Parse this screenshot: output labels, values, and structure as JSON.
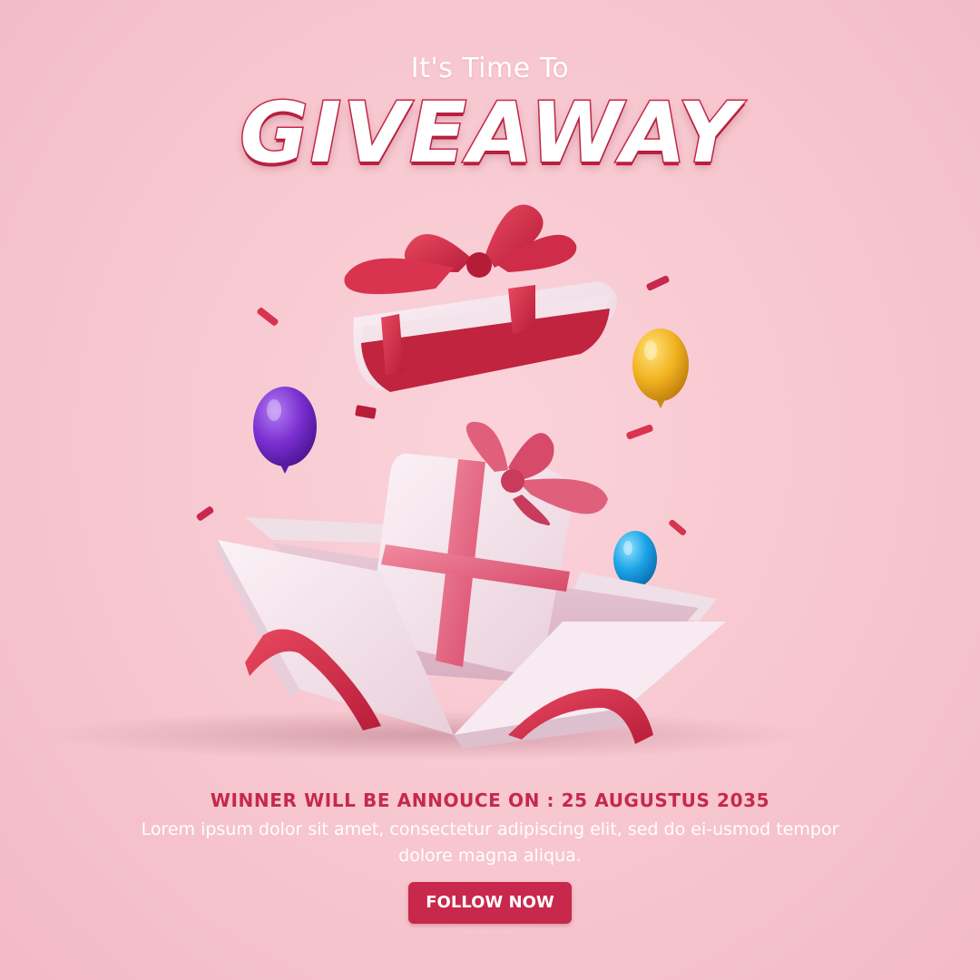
{
  "header": {
    "subtitle": "It's Time To",
    "title": "GIVEAWAY"
  },
  "announcement": {
    "winner_line": "WINNER WILL BE ANNOUCE ON : 25 AUGUSTUS 2035",
    "description": "Lorem ipsum dolor sit amet, consectetur adipiscing elit, sed do ei-usmod tempor dolore magna aliqua."
  },
  "cta": {
    "follow_label": "FOLLOW NOW"
  },
  "colors": {
    "background": "#f7c6cf",
    "accent": "#c7284b",
    "ribbon": "#d8334f",
    "box": "#f4e6ec",
    "balloon_purple": "#7b2fd0",
    "balloon_yellow": "#f2b321",
    "balloon_blue": "#1aa3e6"
  },
  "illustration": {
    "icons": [
      "open-gift-box-icon",
      "gift-lid-icon",
      "small-gift-icon",
      "balloon-icon",
      "confetti-icon"
    ]
  }
}
